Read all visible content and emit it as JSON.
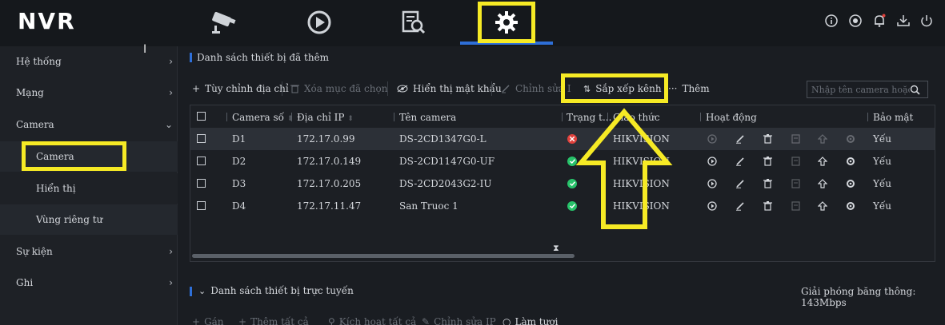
{
  "app": {
    "logo": "NVR"
  },
  "topnav": {
    "icons": [
      "camera-live-icon",
      "playback-icon",
      "search-file-icon",
      "settings-gear-icon"
    ],
    "active": "settings-gear-icon",
    "right_icons": [
      "info-icon",
      "record-icon",
      "bell-icon",
      "download-icon",
      "power-icon"
    ]
  },
  "sidebar": {
    "items": [
      {
        "label": "Hệ thống",
        "chevron": "›"
      },
      {
        "label": "Mạng",
        "chevron": "›"
      },
      {
        "label": "Camera",
        "chevron": "⌄"
      },
      {
        "label": "Camera",
        "chevron": ""
      },
      {
        "label": "Hiển thị",
        "chevron": ""
      },
      {
        "label": "Vùng riêng tư",
        "chevron": ""
      },
      {
        "label": "Sự kiện",
        "chevron": "›"
      },
      {
        "label": "Ghi",
        "chevron": "›"
      }
    ]
  },
  "section1": {
    "title": "Danh sách thiết bị đã thêm",
    "toolbar": {
      "custom_add": "Tùy chỉnh địa chỉ",
      "delete": "Xóa mục đã chọn",
      "show_password": "Hiển thị mật khẩu",
      "edit": "Chỉnh sửa I",
      "sort": "Sắp xếp kênh",
      "more": "Thêm"
    },
    "search_placeholder": "Nhập tên camera hoặc",
    "columns": [
      "Camera số",
      "Địa chỉ IP",
      "Tên camera",
      "Trạng t...",
      "Giao thức",
      "Hoạt động",
      "Bảo mật"
    ],
    "rows": [
      {
        "no": "D1",
        "ip": "172.17.0.99",
        "name": "DS-2CD1347G0-L",
        "status": "error",
        "protocol": "HIKVISION",
        "security": "Yếu"
      },
      {
        "no": "D2",
        "ip": "172.17.0.149",
        "name": "DS-2CD1147G0-UF",
        "status": "ok",
        "protocol": "HIKVISION",
        "security": "Yếu"
      },
      {
        "no": "D3",
        "ip": "172.17.0.205",
        "name": "DS-2CD2043G2-IU",
        "status": "ok",
        "protocol": "HIKVISION",
        "security": "Yếu"
      },
      {
        "no": "D4",
        "ip": "172.17.11.47",
        "name": "San Truoc 1",
        "status": "ok",
        "protocol": "HIKVISION",
        "security": "Yếu"
      }
    ]
  },
  "section2": {
    "title": "Danh sách thiết bị trực tuyến",
    "bandwidth": "Giải phóng băng thông: 143Mbps",
    "toolbar": {
      "add": "Gán",
      "add_all": "Thêm tất cả",
      "activate_all": "Kích hoạt tất cả",
      "edit_ip": "Chỉnh sửa IP",
      "refresh": "Làm tươi"
    }
  },
  "colors": {
    "accent": "#2e6fd8",
    "highlight": "#f6ea25",
    "ok": "#27c26a",
    "error": "#e0413c"
  }
}
